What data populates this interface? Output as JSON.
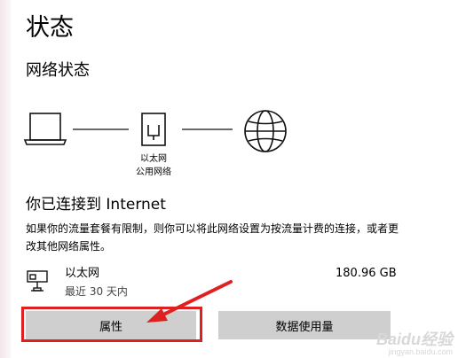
{
  "page": {
    "title": "状态",
    "subtitle": "网络状态"
  },
  "diagram": {
    "adapter_label_line1": "以太网",
    "adapter_label_line2": "公用网络"
  },
  "connection": {
    "title": "你已连接到 Internet",
    "description": "如果你的流量套餐有限制，则你可以将此网络设置为按流量计费的连接，或者更改其他网络属性。"
  },
  "adapter": {
    "name": "以太网",
    "period": "最近 30 天内",
    "usage": "180.96 GB"
  },
  "buttons": {
    "properties": "属性",
    "data_usage": "数据使用量"
  },
  "annotation": {
    "highlight_color": "#e02020"
  },
  "watermark": {
    "brand": "Baidu经验",
    "site": "jingyan.baidu.com"
  },
  "icons": [
    "laptop-icon",
    "ethernet-icon",
    "globe-icon",
    "adapter-icon"
  ]
}
